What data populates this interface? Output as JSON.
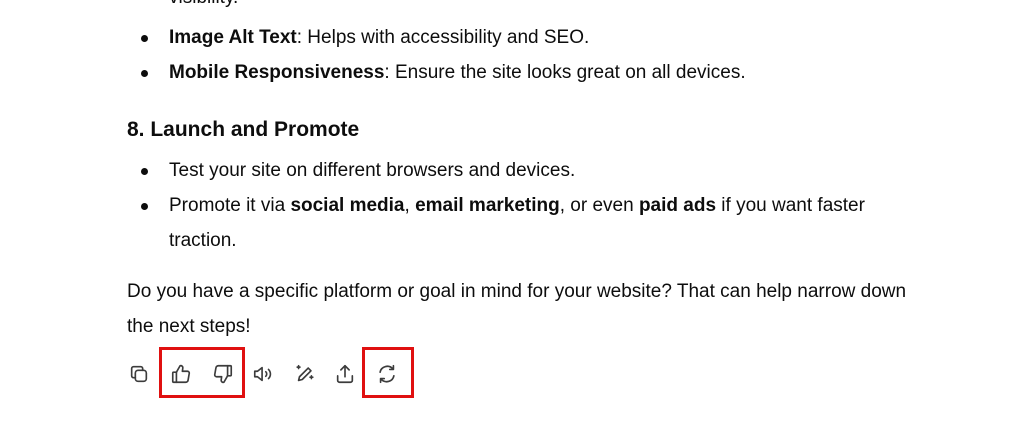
{
  "message": {
    "cut_off_text": "visibility.",
    "seo_items": [
      {
        "term": "Image Alt Text",
        "rest": ": Helps with accessibility and SEO."
      },
      {
        "term": "Mobile Responsiveness",
        "rest": ": Ensure the site looks great on all devices."
      }
    ],
    "section_heading": "8. Launch and Promote",
    "launch_items": {
      "test": "Test your site on different browsers and devices.",
      "promote": {
        "prefix": "Promote it via ",
        "social": "social media",
        "sep1": ", ",
        "email": "email marketing",
        "sep2": ", or even ",
        "paid": "paid ads",
        "suffix": " if you want faster traction."
      }
    },
    "closing": "Do you have a specific platform or goal in mind for your website? That can help narrow down the next steps!"
  },
  "actions": {
    "icons": [
      "copy-icon",
      "thumbs-up-icon",
      "thumbs-down-icon",
      "read-aloud-icon",
      "edit-icon",
      "share-icon",
      "regenerate-icon"
    ],
    "highlight_color": "#e01010"
  }
}
